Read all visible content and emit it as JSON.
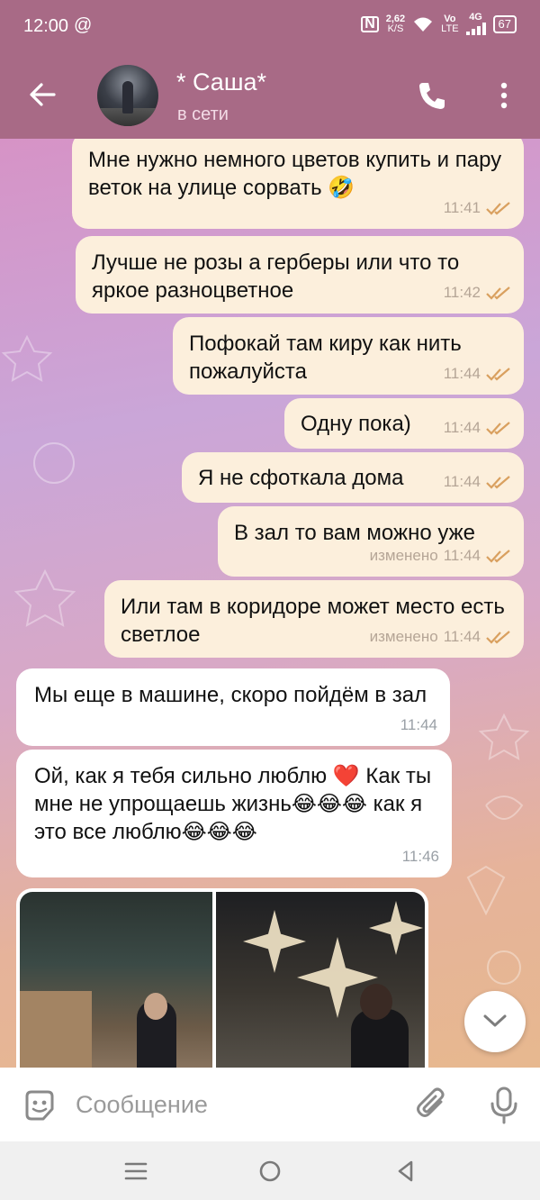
{
  "status_bar": {
    "time": "12:00",
    "at_symbol": "@",
    "nfc": "N",
    "speed_value": "2,62",
    "speed_unit": "K/S",
    "volte_top": "Vo",
    "volte_bottom": "LTE",
    "network": "4G",
    "battery": "67"
  },
  "header": {
    "contact_name": "* Саша*",
    "status": "в сети"
  },
  "messages": [
    {
      "text": "Мне нужно немного цветов купить и пару веток на улице сорвать 🤣",
      "time": "11:41"
    },
    {
      "text": "Лучше не розы а герберы или что то яркое разноцветное",
      "time": "11:42"
    },
    {
      "text": "Пофокай там киру как нить пожалуйста",
      "time": "11:44"
    },
    {
      "text": "Одну пока)",
      "time": "11:44"
    },
    {
      "text": "Я не сфоткала дома",
      "time": "11:44"
    },
    {
      "text": "В зал то вам можно уже",
      "time": "11:44",
      "edited": "изменено"
    },
    {
      "text": "Или там в коридоре может место есть светлое",
      "time": "11:44",
      "edited": "изменено"
    },
    {
      "text": "Мы еще в машине, скоро пойдём в зал",
      "time": "11:44"
    },
    {
      "text": "Ой, как я тебя сильно люблю ❤️ Как ты мне не упрощаешь жизнь😂😂😂 как я это все люблю😂😂😂",
      "time": "11:46"
    }
  ],
  "composer": {
    "placeholder": "Сообщение"
  },
  "colors": {
    "header_bg": "#a86a86",
    "outgoing_bubble": "#fcefdc",
    "incoming_bubble": "#ffffff",
    "read_ticks": "#d9a05f"
  },
  "icons": [
    "back-arrow-icon",
    "phone-icon",
    "more-vertical-icon",
    "sticker-emoji-icon",
    "paperclip-icon",
    "microphone-icon",
    "chevron-down-icon",
    "nav-menu-icon",
    "nav-home-icon",
    "nav-back-icon"
  ]
}
